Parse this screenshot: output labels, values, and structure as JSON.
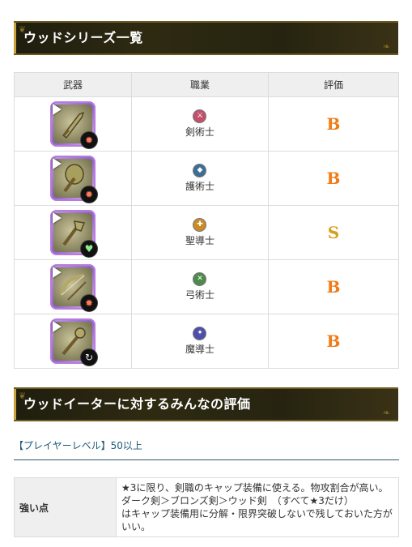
{
  "section1": {
    "title": "ウッドシリーズ一覧"
  },
  "table": {
    "headers": {
      "weapon": "武器",
      "job": "職業",
      "rating": "評価"
    },
    "rows": [
      {
        "weapon_icon": "wood-sword-icon",
        "element_icon": "fire-icon",
        "job_icon": "sword-icon",
        "job_color": "#c2506b",
        "job": "剣術士",
        "rating": "B"
      },
      {
        "weapon_icon": "wood-shield-icon",
        "element_icon": "fire-icon",
        "job_icon": "shield-icon",
        "job_color": "#3d6e93",
        "job": "護術士",
        "rating": "B"
      },
      {
        "weapon_icon": "wood-staff-icon",
        "element_icon": "heart-icon",
        "job_icon": "holy-icon",
        "job_color": "#c98b28",
        "job": "聖導士",
        "rating": "S"
      },
      {
        "weapon_icon": "wood-bow-icon",
        "element_icon": "fire-icon",
        "job_icon": "bow-icon",
        "job_color": "#4f8a4a",
        "job": "弓術士",
        "rating": "B"
      },
      {
        "weapon_icon": "wood-wand-icon",
        "element_icon": "swirl-icon",
        "job_icon": "magic-icon",
        "job_color": "#4e4fa8",
        "job": "魔導士",
        "rating": "B"
      }
    ]
  },
  "section2": {
    "title": "ウッドイーターに対するみんなの評価"
  },
  "player_level": "【プレイヤーレベル】50以上",
  "review": {
    "label": "強い点",
    "lines": [
      "★3に限り、剣職のキャップ装備に使える。物攻割合が高い。",
      "ダーク剣＞ブロンズ剣＞ウッド剣　（すべて★3だけ）",
      "はキャップ装備用に分解・限界突破しないで残しておいた方が",
      "いい。"
    ]
  }
}
